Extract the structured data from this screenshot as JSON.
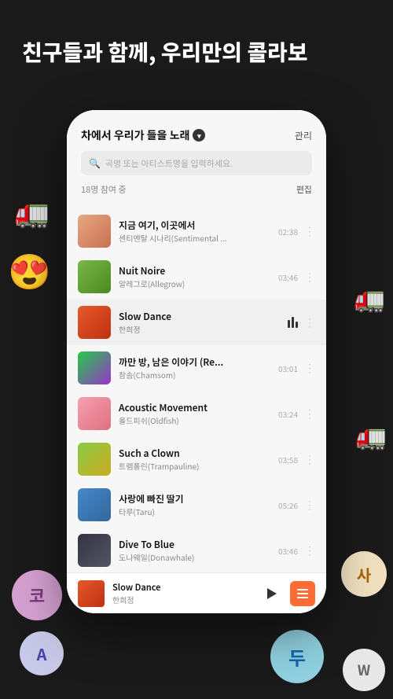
{
  "header": {
    "title": "친구들과 함께, 우리만의 콜라보"
  },
  "phone": {
    "playlist": {
      "title": "차에서 우리가 들을 노래",
      "manage_label": "관리",
      "participants": "18명 참여 중",
      "edit_label": "편집",
      "search_placeholder": "곡명 또는 아티스트명을 입력하세요."
    },
    "songs": [
      {
        "title": "지금 여기, 이곳에서",
        "artist": "센티멘탈 시나리(Sentimental ...",
        "duration": "02:38",
        "thumb_class": "thumb-1",
        "playing": false
      },
      {
        "title": "Nuit Noire",
        "artist": "알레그로(Allegrow)",
        "duration": "03:46",
        "thumb_class": "thumb-2",
        "playing": false
      },
      {
        "title": "Slow Dance",
        "artist": "한희정",
        "duration": "",
        "thumb_class": "thumb-3",
        "playing": true
      },
      {
        "title": "까만 방, 남은 이야기 (Re...",
        "artist": "참솜(Chamsom)",
        "duration": "03:01",
        "thumb_class": "thumb-4",
        "playing": false
      },
      {
        "title": "Acoustic Movement",
        "artist": "올드피쉬(Oldfish)",
        "duration": "03:24",
        "thumb_class": "thumb-5",
        "playing": false
      },
      {
        "title": "Such a Clown",
        "artist": "트램폴린(Trampauline)",
        "duration": "03:58",
        "thumb_class": "thumb-6",
        "playing": false
      },
      {
        "title": "사랑에 빠진 딸기",
        "artist": "타루(Taru)",
        "duration": "05:26",
        "thumb_class": "thumb-7",
        "playing": false
      },
      {
        "title": "Dive To Blue",
        "artist": "도나웨일(Donawhale)",
        "duration": "03:46",
        "thumb_class": "thumb-8",
        "playing": false
      }
    ],
    "mini_player": {
      "title": "Slow Dance",
      "artist": "한희정",
      "play_label": "▶",
      "queue_label": "queue"
    }
  },
  "floating": {
    "ko": "코",
    "a": "A",
    "sa": "사",
    "du": "두",
    "w": "W"
  }
}
